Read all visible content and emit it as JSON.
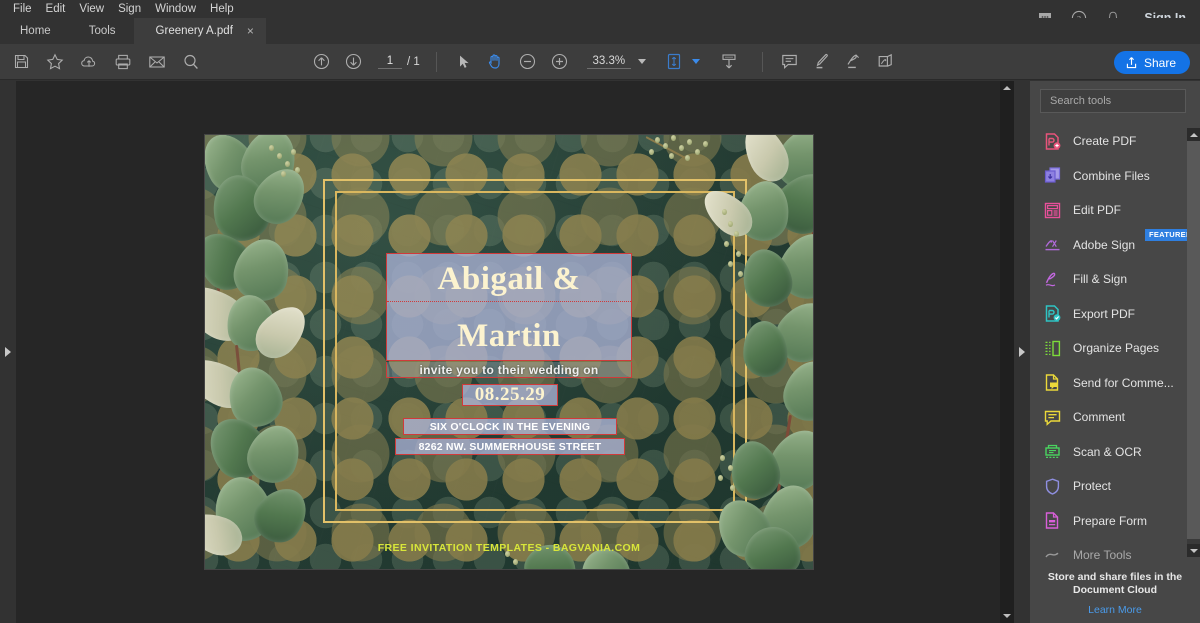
{
  "menubar": {
    "items": [
      "File",
      "Edit",
      "View",
      "Sign",
      "Window",
      "Help"
    ]
  },
  "topright": {
    "icons": [
      "chat-icon",
      "help-icon",
      "bell-icon"
    ],
    "signin_label": "Sign In"
  },
  "tabs": {
    "home_label": "Home",
    "tools_label": "Tools",
    "document_label": "Greenery A.pdf",
    "close_label": "×"
  },
  "toolbar": {
    "left_icons": [
      "save-icon",
      "star-icon",
      "upload-cloud-icon",
      "print-icon",
      "email-icon",
      "search-icon"
    ],
    "page_current": "1",
    "page_separator": "/ 1",
    "zoom_value": "33.3%",
    "mid_icons": [
      "scroll-up-icon",
      "scroll-down-icon",
      "select-cursor-icon",
      "hand-tool-icon",
      "zoom-out-icon",
      "zoom-in-icon",
      "fit-page-icon",
      "scroll-mode-icon",
      "comment-icon",
      "highlight-icon",
      "draw-icon",
      "sign-icon"
    ],
    "share_label": "Share"
  },
  "document": {
    "invitation": {
      "names_line1": "Abigail &",
      "names_line2": "Martin",
      "invite_text": "invite you to their wedding on",
      "date": "08.25.29",
      "time": "SIX O'CLOCK IN THE EVENING",
      "address": "8262 NW. SUMMERHOUSE STREET",
      "credit": "FREE INVITATION TEMPLATES - BAGVANIA.COM"
    },
    "colors": {
      "background_green": "#243c33",
      "gold_frame": "#e2c169",
      "cream_text": "#fcf3cf",
      "field_fill": "#aab2d6",
      "field_border": "#d03a3a",
      "credit_yellow": "#d8e63a"
    }
  },
  "tools_panel": {
    "search_placeholder": "Search tools",
    "items": [
      {
        "label": "Create PDF",
        "icon": "create-pdf-icon",
        "color": "#e8547b",
        "badge": ""
      },
      {
        "label": "Combine Files",
        "icon": "combine-files-icon",
        "color": "#7a6ddb",
        "badge": ""
      },
      {
        "label": "Edit PDF",
        "icon": "edit-pdf-icon",
        "color": "#e8509a",
        "badge": ""
      },
      {
        "label": "Adobe Sign",
        "icon": "adobe-sign-icon",
        "color": "#b06ad9",
        "badge": "FEATURED"
      },
      {
        "label": "Fill & Sign",
        "icon": "fill-sign-icon",
        "color": "#c368e0",
        "badge": ""
      },
      {
        "label": "Export PDF",
        "icon": "export-pdf-icon",
        "color": "#2fc4c4",
        "badge": ""
      },
      {
        "label": "Organize Pages",
        "icon": "organize-pages-icon",
        "color": "#7ddc3a",
        "badge": ""
      },
      {
        "label": "Send for Comme...",
        "icon": "send-for-comment-icon",
        "color": "#ecd93a",
        "badge": ""
      },
      {
        "label": "Comment",
        "icon": "comment-icon",
        "color": "#ecd93a",
        "badge": ""
      },
      {
        "label": "Scan & OCR",
        "icon": "scan-ocr-icon",
        "color": "#4ad45f",
        "badge": ""
      },
      {
        "label": "Protect",
        "icon": "protect-icon",
        "color": "#8f8fe0",
        "badge": ""
      },
      {
        "label": "Prepare Form",
        "icon": "prepare-form-icon",
        "color": "#d95fd9",
        "badge": ""
      },
      {
        "label": "More Tools",
        "icon": "more-tools-icon",
        "color": "#cccccc",
        "badge": ""
      }
    ],
    "footer_title_line1": "Store and share files in the",
    "footer_title_line2": "Document Cloud",
    "footer_link": "Learn More"
  }
}
